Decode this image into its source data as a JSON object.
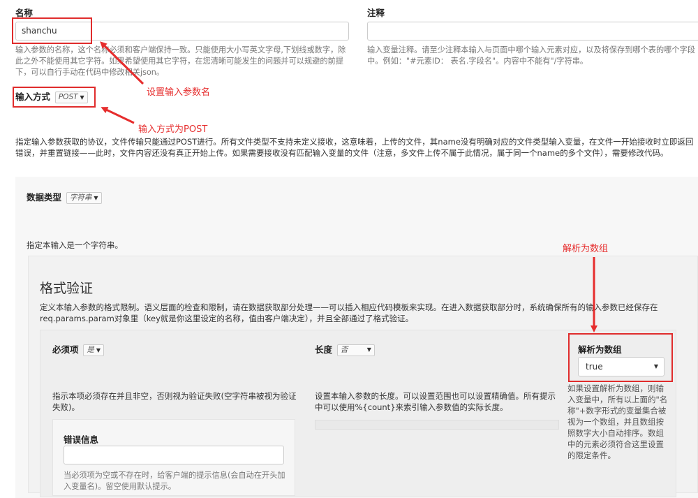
{
  "name_field": {
    "label": "名称",
    "value": "shanchu",
    "help": "输入参数的名称，这个名称必须和客户端保持一致。只能使用大小写英文字母,下划线或数字，除此之外不能使用其它字符。如果希望使用其它字符，在您清晰可能发生的问题并可以规避的前提下，可以自行手动在代码中修改相关json。"
  },
  "comment_field": {
    "label": "注释",
    "value": "",
    "help": "输入变量注释。请至少注释本输入与页面中哪个输入元素对应，以及将保存到哪个表的哪个字段中。例如：\"#元素ID： 表名.字段名\"。内容中不能有\"/字符串。"
  },
  "input_method": {
    "label": "输入方式",
    "value": "POST",
    "help": "指定输入参数获取的协议，文件传输只能通过POST进行。所有文件类型不支持未定义接收，这意味着，上传的文件，其name没有明确对应的文件类型输入变量，在文件一开始接收时立即返回错误，并重置链接——此时，文件内容还没有真正开始上传。如果需要接收没有匹配输入变量的文件（注意，多文件上传不属于此情况，属于同一个name的多个文件），需要修改代码。"
  },
  "data_type": {
    "label": "数据类型",
    "value": "字符串",
    "help": "指定本输入是一个字符串。"
  },
  "format": {
    "title": "格式验证",
    "desc": "定义本输入参数的格式限制。语义层面的检查和限制，请在数据获取部分处理——可以插入相应代码模板来实现。在进入数据获取部分时，系统确保所有的输入参数已经保存在req.params.param对象里（key就是你这里设定的名称，值由客户端决定），并且全部通过了格式验证。"
  },
  "required": {
    "label": "必须项",
    "value": "是",
    "help": "指示本项必须存在并且非空，否则视为验证失败(空字符串被视为验证失败)。"
  },
  "length": {
    "label": "长度",
    "value": "否",
    "help": "设置本输入参数的长度。可以设置范围也可以设置精确值。所有提示中可以使用%{count}来索引输入参数值的实际长度。"
  },
  "parse_array": {
    "label": "解析为数组",
    "value": "true",
    "help": "如果设置解析为数组，则输入变量中，所有以上面的\"名称\"+数字形式的变量集合被视为一个数组，并且数组按照数字大小自动排序。数组中的元素必须符合这里设置的限定条件。"
  },
  "error_info": {
    "label": "错误信息",
    "value": "",
    "help": "当必须项为空或不存在时，给客户端的提示信息(会自动在开头加入变量名)。留空使用默认提示。"
  },
  "annotations": {
    "set_name": "设置输入参数名",
    "method_post": "输入方式为POST",
    "parse_array": "解析为数组"
  },
  "colors": {
    "annotation": "#e62d2d"
  }
}
